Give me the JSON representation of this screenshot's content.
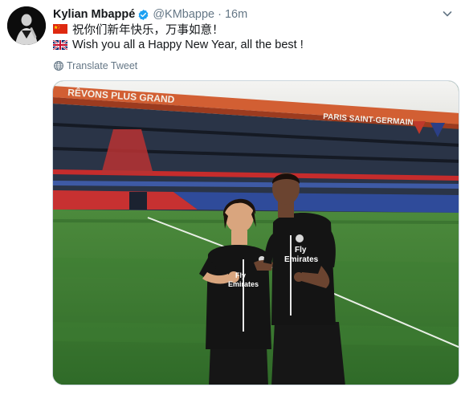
{
  "tweet": {
    "author_name": "Kylian Mbappé",
    "author_handle": "@KMbappe",
    "separator": "·",
    "timestamp": "16m",
    "verified": true,
    "lines": [
      {
        "flag": "china-flag-icon",
        "text": "祝你们新年快乐，万事如意！"
      },
      {
        "flag": "uk-flag-icon",
        "text": "Wish you all a Happy New Year, all the best !"
      }
    ],
    "translate_label": "Translate Tweet",
    "media": {
      "banner_text_left": "RÊVONS PLUS GRAND",
      "banner_text_right": "PARIS SAINT-GERMAIN",
      "shirt_text_line1": "Fly",
      "shirt_text_line2": "Emirates"
    }
  },
  "colors": {
    "verified": "#1da1f2",
    "secondary_text": "#657786",
    "stadium_red": "#d92b2b",
    "stadium_blue": "#1f3f8f",
    "pitch": "#3d7d33"
  }
}
